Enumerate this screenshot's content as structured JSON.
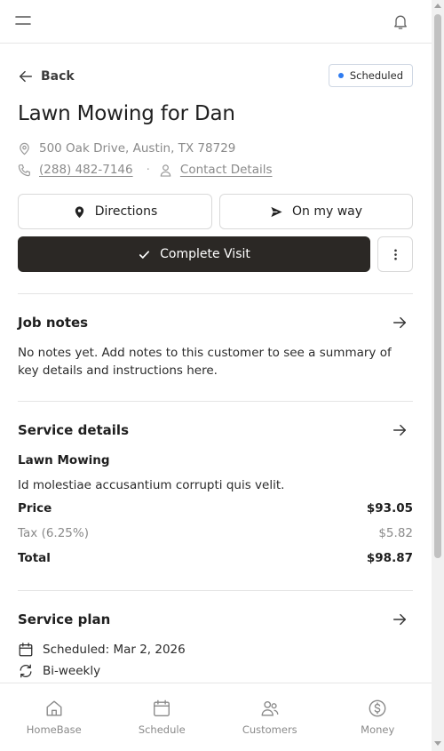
{
  "header": {
    "menu_icon": "hamburger-menu-icon",
    "notification_icon": "bell-icon"
  },
  "job": {
    "back_label": "Back",
    "status": "Scheduled",
    "status_color": "#2f7bf0",
    "title": "Lawn Mowing for Dan",
    "address": "500 Oak Drive, Austin, TX 78729",
    "phone": "(288) 482-7146",
    "separator": "·",
    "contact_label": "Contact Details"
  },
  "actions": {
    "directions": "Directions",
    "on_my_way": "On my way",
    "complete": "Complete Visit",
    "complete_color": "#2b2825"
  },
  "job_notes": {
    "title": "Job notes",
    "text": "No notes yet. Add notes to this customer to see a summary of key details and instructions here."
  },
  "service_details": {
    "title": "Service details",
    "service_name": "Lawn Mowing",
    "description": "Id molestiae accusantium corrupti quis velit.",
    "price_label": "Price",
    "price_value": "$93.05",
    "tax_label": "Tax (6.25%)",
    "tax_value": "$5.82",
    "total_label": "Total",
    "total_value": "$98.87"
  },
  "service_plan": {
    "title": "Service plan",
    "scheduled": "Scheduled: Mar 2, 2026",
    "frequency": "Bi-weekly"
  },
  "tabs": [
    {
      "label": "HomeBase",
      "icon": "home-icon"
    },
    {
      "label": "Schedule",
      "icon": "calendar-icon"
    },
    {
      "label": "Customers",
      "icon": "users-icon"
    },
    {
      "label": "Money",
      "icon": "dollar-icon"
    }
  ]
}
